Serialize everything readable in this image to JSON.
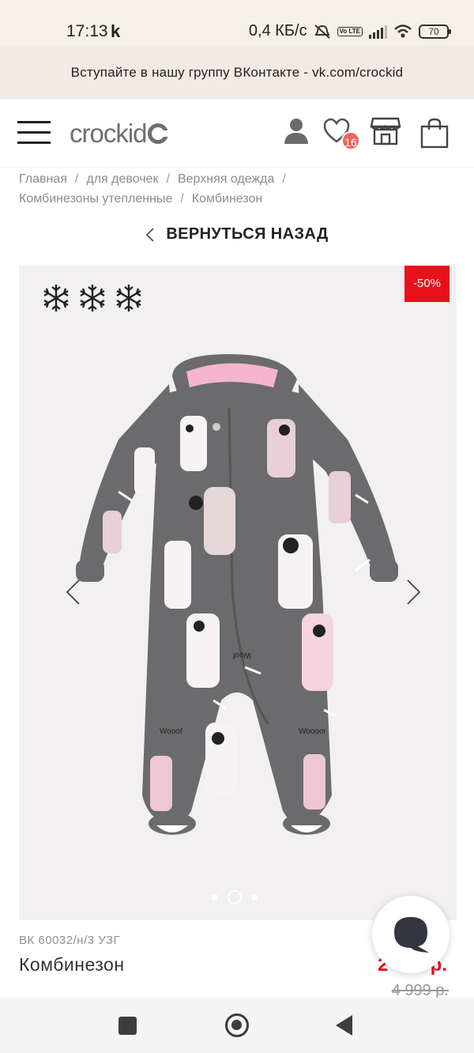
{
  "status_bar": {
    "time": "17:13",
    "carrier_glyph": "k",
    "network_speed": "0,4 КБ/с",
    "battery": "70",
    "lte": "Vo LTE"
  },
  "promo": {
    "text": "Вступайте в нашу группу ВКонтакте - vk.com/crockid"
  },
  "header": {
    "logo_text": "crockid",
    "wishlist_count": "16"
  },
  "breadcrumb": {
    "items": [
      "Главная",
      "для девочек",
      "Верхняя одежда",
      "Комбинезоны утепленные",
      "Комбинезон"
    ],
    "separator": "/"
  },
  "back_link": {
    "label": "ВЕРНУТЬСЯ НАЗАД"
  },
  "gallery": {
    "discount": "-50%",
    "warmth_icons": [
      "snowflake-icon",
      "snowflake-icon",
      "snowflake-icon"
    ],
    "slide_count": 3,
    "active_slide": 1,
    "print_texts": [
      "Woof",
      "Wooof",
      "Woooor"
    ]
  },
  "product": {
    "sku": "ВК 60032/н/3 УЗГ",
    "name": "Комбинезон",
    "price": "2 499 р.",
    "old_price": "4 999 р."
  },
  "colors": {
    "accent_red": "#e8101a",
    "badge": "#f0635e",
    "promo_bg": "#f1ebe3",
    "suit_gray": "#6b6b6e",
    "suit_pink": "#f4b6cc"
  }
}
